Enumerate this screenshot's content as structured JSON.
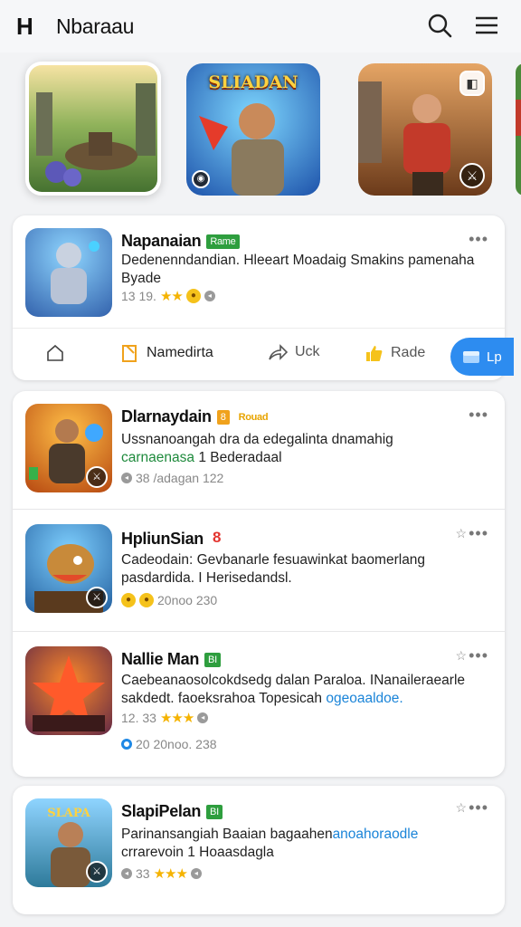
{
  "header": {
    "logo": "H",
    "title": "Nbaraau",
    "search_icon": "search-icon",
    "menu_icon": "menu-icon"
  },
  "hero": [
    {
      "title": ""
    },
    {
      "title": "SLIADAN"
    },
    {
      "title": ""
    }
  ],
  "featured": {
    "name": "Napanaian",
    "tag": "Rame",
    "desc": "Dedenenndandian. Hleeart Moadaig Smakins pamenaha Byade",
    "meta": "13 19.",
    "actions": {
      "share": "Uck",
      "name": "Namedirta",
      "rate": "Rade",
      "primary": "Lp"
    }
  },
  "list": [
    {
      "name": "Dlarnaydain",
      "tag": "8",
      "tag2": "Rouad",
      "desc_a": "Ussnanoangah dra da edegalinta dnamahig",
      "desc_b": "carnaenasa",
      "desc_c": " 1 Bederadaal",
      "meta": "38 /adagan 122"
    },
    {
      "name": "HpliunSian",
      "tag": "8",
      "desc_a": "Cadeodain: Gevbanarle fesuawinkat baomerlang",
      "desc_b": "pasdardida. I Herisedandsl.",
      "meta": "20noo 230"
    },
    {
      "name": "Nallie Man",
      "tag": "BI",
      "desc_a": "Caebeanaosolcokdsedg dalan Paraloa. INanaileraearle",
      "desc_b": "sakdedt. faoeksrahoa Topesicah",
      "desc_c": "ogeoaaldoe.",
      "meta1": "12. 33",
      "meta2": "20 20noo. 238"
    }
  ],
  "last": {
    "name": "SlapiPelan",
    "tag": "BI",
    "desc_a": "Parinansangiah Baaian bagaahen",
    "desc_b": "anoahoraodle",
    "desc_c": "crrarevoin 1 Hoaasdagla",
    "meta": "33"
  }
}
